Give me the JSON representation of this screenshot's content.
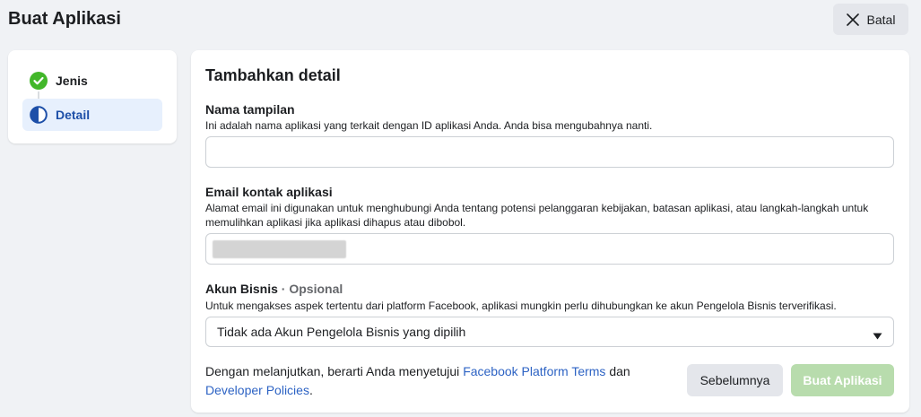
{
  "header": {
    "title": "Buat Aplikasi",
    "cancel_label": "Batal"
  },
  "steps": [
    {
      "label": "Jenis",
      "status": "complete",
      "icon": "check-circle-icon"
    },
    {
      "label": "Detail",
      "status": "current",
      "icon": "half-circle-icon"
    }
  ],
  "form": {
    "title": "Tambahkan detail",
    "display_name": {
      "label": "Nama tampilan",
      "help": "Ini adalah nama aplikasi yang terkait dengan ID aplikasi Anda. Anda bisa mengubahnya nanti.",
      "value": ""
    },
    "contact_email": {
      "label": "Email kontak aplikasi",
      "help": "Alamat email ini digunakan untuk menghubungi Anda tentang potensi pelanggaran kebijakan, batasan aplikasi, atau langkah-langkah untuk memulihkan aplikasi jika aplikasi dihapus atau dibobol.",
      "value": ""
    },
    "business_account": {
      "label": "Akun Bisnis",
      "optional": "· Opsional",
      "help": "Untuk mengakses aspek tertentu dari platform Facebook, aplikasi mungkin perlu dihubungkan ke akun Pengelola Bisnis terverifikasi.",
      "selected": "Tidak ada Akun Pengelola Bisnis yang dipilih"
    }
  },
  "footer": {
    "terms_prefix": "Dengan melanjutkan, berarti Anda menyetujui ",
    "terms_link1": "Facebook Platform Terms",
    "terms_mid": " dan",
    "terms_link2": "Developer Policies",
    "terms_suffix": ".",
    "prev_label": "Sebelumnya",
    "create_label": "Buat Aplikasi"
  },
  "colors": {
    "accent": "#1877f2",
    "link": "#2d63c4",
    "success": "#42b72a",
    "create_disabled": "#b8dcad"
  }
}
